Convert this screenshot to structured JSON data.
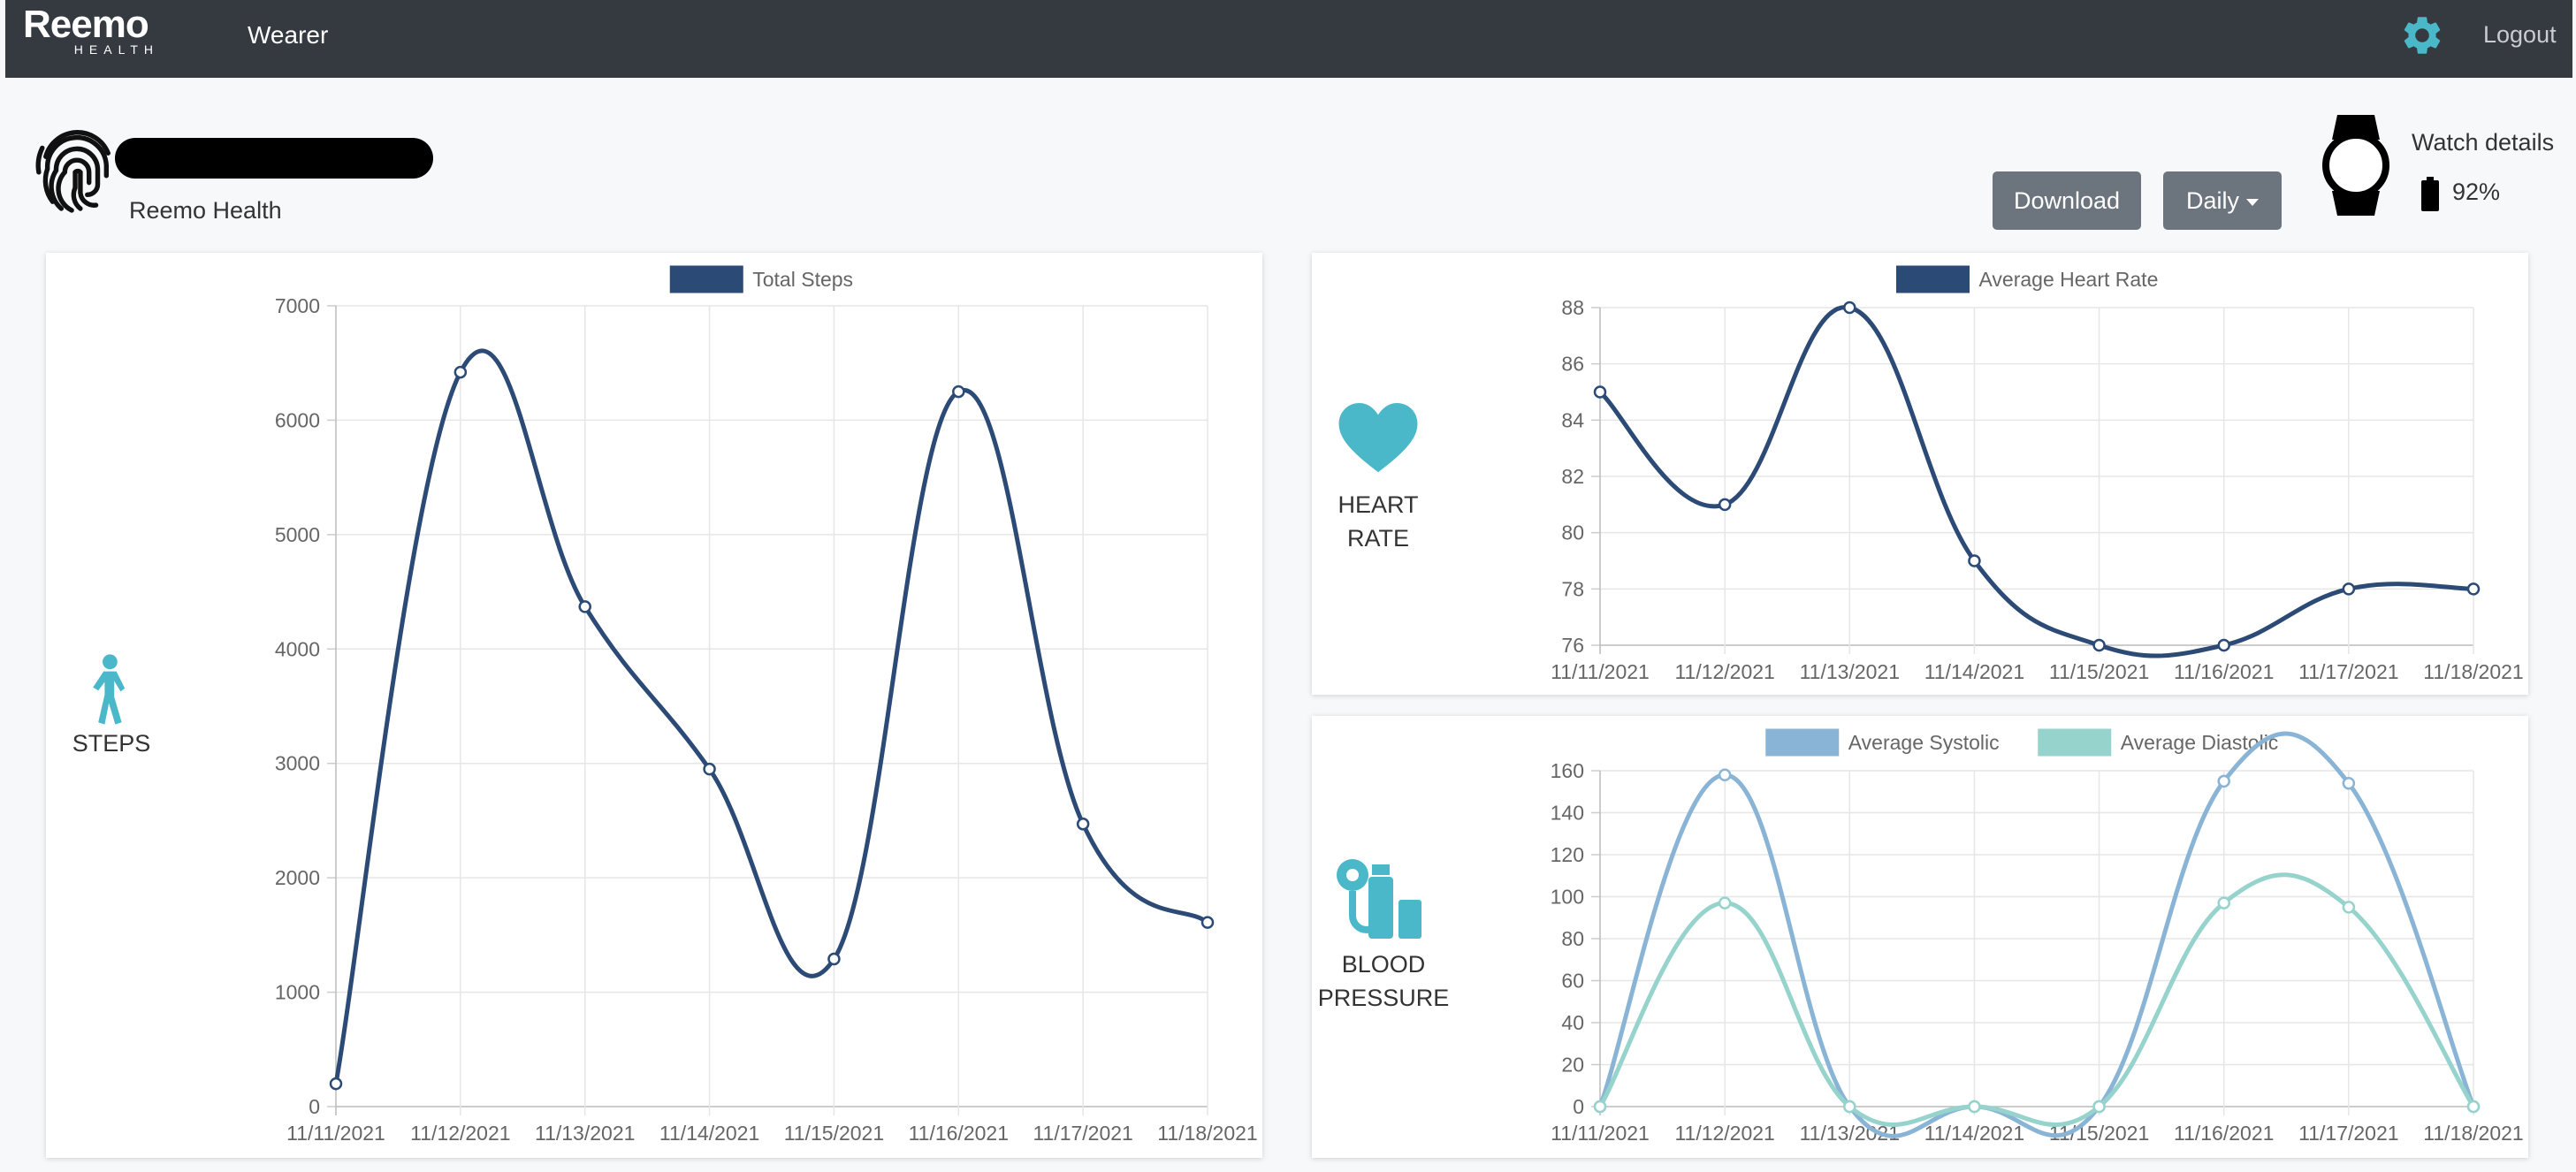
{
  "brand": {
    "name": "Reemo",
    "sub": "HEALTH"
  },
  "nav": {
    "wearer": "Wearer",
    "logout": "Logout"
  },
  "icons": {
    "settings": "gear-icon",
    "profile": "fingerprint-icon",
    "watch": "smartwatch-icon",
    "battery": "battery-icon",
    "steps": "walking-person-icon",
    "heart": "heart-icon",
    "blood_pressure": "blood-pressure-monitor-icon"
  },
  "colors": {
    "topbar": "#343a40",
    "accent": "#4ab8c8",
    "steps_line": "#2c4a76",
    "systolic": "#8ab4d6",
    "diastolic": "#96d3cc"
  },
  "profile": {
    "org": "Reemo Health"
  },
  "actions": {
    "download": "Download",
    "period": "Daily"
  },
  "watch": {
    "label": "Watch details",
    "battery": "92%",
    "battery_level": 0.92
  },
  "cards": {
    "steps": {
      "label": "STEPS"
    },
    "heart": {
      "label_line1": "HEART",
      "label_line2": "RATE"
    },
    "bp": {
      "label_line1": "BLOOD",
      "label_line2": "PRESSURE"
    }
  },
  "chart_data": [
    {
      "type": "line",
      "x": [
        "11/11/2021",
        "11/12/2021",
        "11/13/2021",
        "11/14/2021",
        "11/15/2021",
        "11/16/2021",
        "11/17/2021",
        "11/18/2021"
      ],
      "series": [
        {
          "name": "Total Steps",
          "values": [
            200,
            6420,
            4370,
            2950,
            1290,
            6250,
            2470,
            1610
          ]
        }
      ],
      "ylim": [
        0,
        7000
      ],
      "yticks": [
        0,
        1000,
        2000,
        3000,
        4000,
        5000,
        6000,
        7000
      ],
      "grid": true,
      "legend": "top"
    },
    {
      "type": "line",
      "x": [
        "11/11/2021",
        "11/12/2021",
        "11/13/2021",
        "11/14/2021",
        "11/15/2021",
        "11/16/2021",
        "11/17/2021",
        "11/18/2021"
      ],
      "series": [
        {
          "name": "Average Heart Rate",
          "values": [
            85,
            81,
            88,
            79,
            76,
            76,
            78,
            78
          ]
        }
      ],
      "ylim": [
        76,
        88
      ],
      "yticks": [
        76,
        78,
        80,
        82,
        84,
        86,
        88
      ],
      "grid": true,
      "legend": "top"
    },
    {
      "type": "line",
      "x": [
        "11/11/2021",
        "11/12/2021",
        "11/13/2021",
        "11/14/2021",
        "11/15/2021",
        "11/16/2021",
        "11/17/2021",
        "11/18/2021"
      ],
      "series": [
        {
          "name": "Average Systolic",
          "values": [
            0,
            158,
            0,
            0,
            0,
            155,
            154,
            0
          ]
        },
        {
          "name": "Average Diastolic",
          "values": [
            0,
            97,
            0,
            0,
            0,
            97,
            95,
            0
          ]
        }
      ],
      "ylim": [
        0,
        160
      ],
      "yticks": [
        0,
        20,
        40,
        60,
        80,
        100,
        120,
        140,
        160
      ],
      "grid": true,
      "legend": "top"
    }
  ]
}
